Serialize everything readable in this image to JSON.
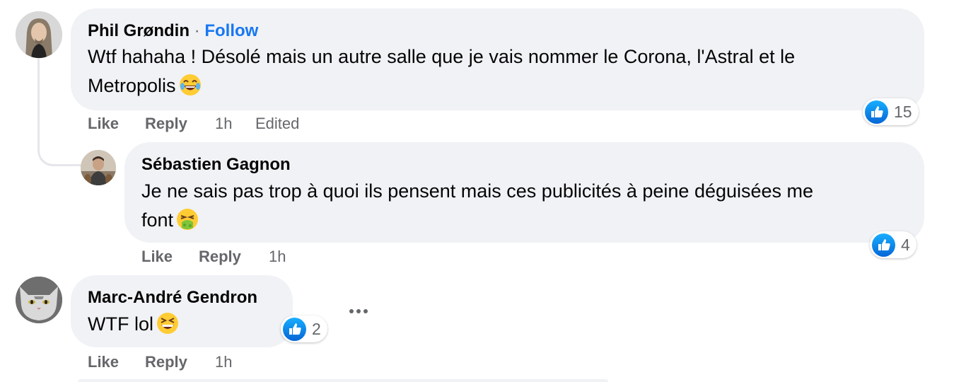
{
  "comments": [
    {
      "author": "Phil Grøndin",
      "separator": "·",
      "follow_label": "Follow",
      "text_line1": "Wtf hahaha ! Désolé mais un autre salle que je vais nommer le Corona, l'Astral et le",
      "text_line2": "Metropolis",
      "emoji": "laughing-tears-emoji",
      "like_label": "Like",
      "reply_label": "Reply",
      "time": "1h",
      "edited_label": "Edited",
      "reaction_count": "15"
    },
    {
      "author": "Sébastien Gagnon",
      "text_line1": "Je ne sais pas trop à quoi ils pensent mais ces publicités à peine déguisées me",
      "text_line2": "font",
      "emoji": "vomiting-face-emoji",
      "like_label": "Like",
      "reply_label": "Reply",
      "time": "1h",
      "reaction_count": "4"
    },
    {
      "author": "Marc-André Gendron",
      "text_line1": "WTF lol",
      "emoji": "grinning-squinting-emoji",
      "like_label": "Like",
      "reply_label": "Reply",
      "time": "1h",
      "reaction_count": "2"
    }
  ],
  "colors": {
    "bubble": "#f0f2f5",
    "link": "#1877f2",
    "secondary_text": "#65676b",
    "like_blue": "#1877f2"
  }
}
